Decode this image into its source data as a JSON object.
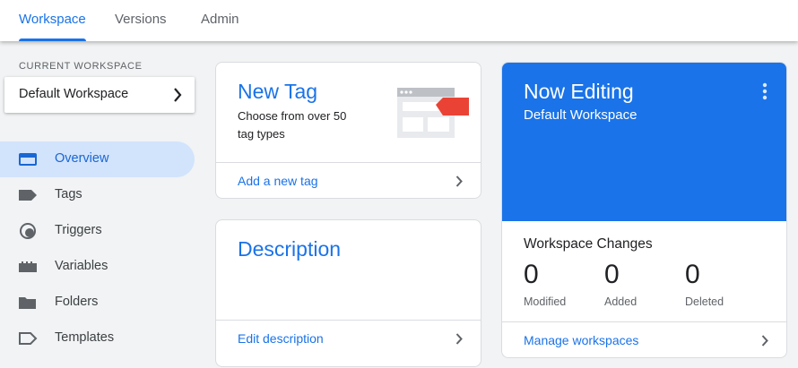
{
  "tabs": {
    "workspace": "Workspace",
    "versions": "Versions",
    "admin": "Admin"
  },
  "sidebar": {
    "current_workspace_label": "CURRENT WORKSPACE",
    "workspace_name": "Default Workspace",
    "items": [
      {
        "label": "Overview",
        "icon": "overview-icon"
      },
      {
        "label": "Tags",
        "icon": "tag-icon"
      },
      {
        "label": "Triggers",
        "icon": "trigger-icon"
      },
      {
        "label": "Variables",
        "icon": "variables-icon"
      },
      {
        "label": "Folders",
        "icon": "folder-icon"
      },
      {
        "label": "Templates",
        "icon": "template-icon"
      }
    ]
  },
  "new_tag": {
    "title": "New Tag",
    "description": "Choose from over 50 tag types",
    "link": "Add a new tag"
  },
  "description_card": {
    "title": "Description",
    "link": "Edit description"
  },
  "now_editing": {
    "title": "Now Editing",
    "workspace": "Default Workspace",
    "changes_title": "Workspace Changes",
    "stats": [
      {
        "value": "0",
        "label": "Modified"
      },
      {
        "value": "0",
        "label": "Added"
      },
      {
        "value": "0",
        "label": "Deleted"
      }
    ],
    "link": "Manage workspaces"
  },
  "colors": {
    "accent": "#1a73e8",
    "tag_red": "#ea4335"
  }
}
